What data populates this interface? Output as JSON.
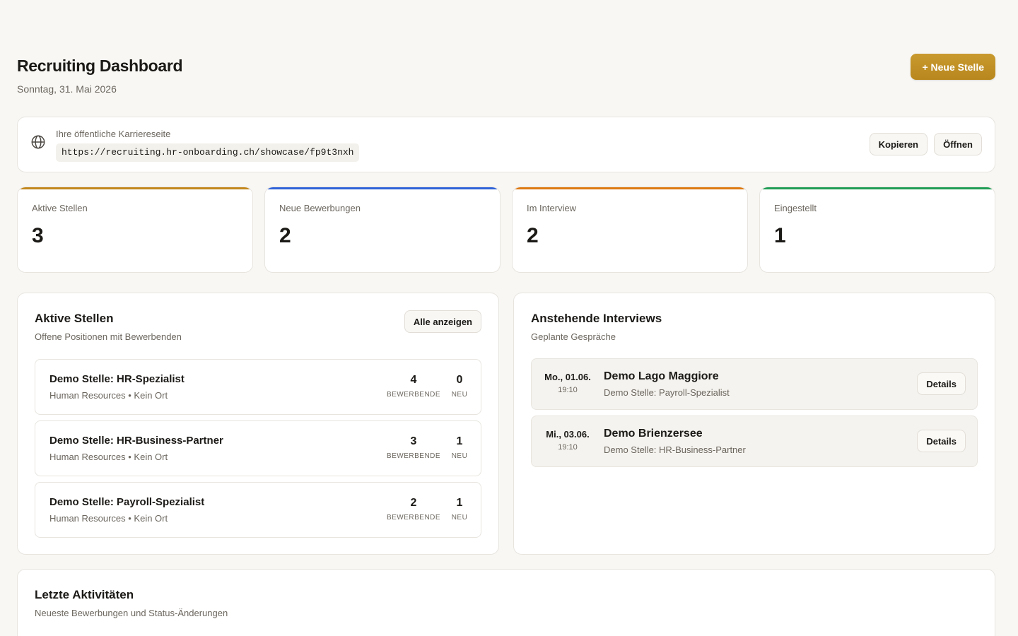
{
  "header": {
    "title": "Recruiting Dashboard",
    "date": "Sonntag, 31. Mai 2026",
    "new_job_label": "+ Neue Stelle"
  },
  "career": {
    "label": "Ihre öffentliche Karriereseite",
    "url": "https://recruiting.hr-onboarding.ch/showcase/fp9t3nxh",
    "copy_label": "Kopieren",
    "open_label": "Öffnen",
    "icon": "globe-icon"
  },
  "stats": [
    {
      "label": "Aktive Stellen",
      "value": "3",
      "color": "#c2871c"
    },
    {
      "label": "Neue Bewerbungen",
      "value": "2",
      "color": "#2f63d8"
    },
    {
      "label": "Im Interview",
      "value": "2",
      "color": "#dd7a12"
    },
    {
      "label": "Eingestellt",
      "value": "1",
      "color": "#1f9d55"
    }
  ],
  "jobs": {
    "title": "Aktive Stellen",
    "subtitle": "Offene Positionen mit Bewerbenden",
    "all_label": "Alle anzeigen",
    "applicants_label": "BEWERBENDE",
    "new_label": "NEU",
    "items": [
      {
        "title": "Demo Stelle: HR-Spezialist",
        "meta": "Human Resources • Kein Ort",
        "applicants": "4",
        "new": "0"
      },
      {
        "title": "Demo Stelle: HR-Business-Partner",
        "meta": "Human Resources • Kein Ort",
        "applicants": "3",
        "new": "1"
      },
      {
        "title": "Demo Stelle: Payroll-Spezialist",
        "meta": "Human Resources • Kein Ort",
        "applicants": "2",
        "new": "1"
      }
    ]
  },
  "interviews": {
    "title": "Anstehende Interviews",
    "subtitle": "Geplante Gespräche",
    "details_label": "Details",
    "items": [
      {
        "date": "Mo., 01.06.",
        "time": "19:10",
        "name": "Demo Lago Maggiore",
        "job": "Demo Stelle: Payroll-Spezialist"
      },
      {
        "date": "Mi., 03.06.",
        "time": "19:10",
        "name": "Demo Brienzersee",
        "job": "Demo Stelle: HR-Business-Partner"
      }
    ]
  },
  "activity": {
    "title": "Letzte Aktivitäten",
    "subtitle": "Neueste Bewerbungen und Status-Änderungen"
  }
}
